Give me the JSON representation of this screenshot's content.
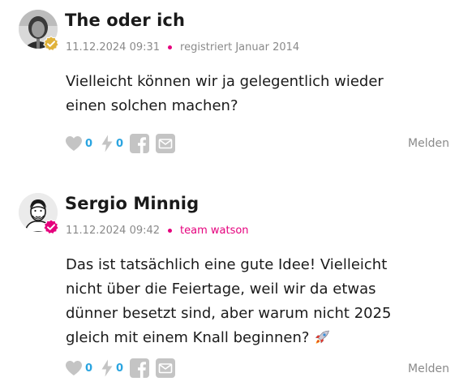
{
  "comments": [
    {
      "author": "The oder ich",
      "timestamp": "11.12.2024 09:31",
      "tag": "registriert Januar 2014",
      "text_lines": [
        "Vielleicht können wir ja gelegentlich wieder",
        "einen solchen machen?"
      ],
      "likes": "0",
      "dislikes": "0",
      "report_label": "Melden",
      "badge_color": "#e0b23a"
    },
    {
      "author": "Sergio Minnig",
      "timestamp": "11.12.2024 09:42",
      "tag": "team watson",
      "text_lines": [
        "Das ist tatsächlich eine gute Idee! Vielleicht",
        "nicht über die Feiertage, weil wir da etwas",
        "dünner besetzt sind, aber warum nicht 2025",
        "gleich mit einem Knall beginnen?"
      ],
      "likes": "0",
      "dislikes": "0",
      "report_label": "Melden",
      "badge_color": "#e5007d"
    }
  ],
  "colors": {
    "accent_pink": "#e5007d",
    "count_blue": "#2aa4e0",
    "icon_gray": "#c4c4c4",
    "meta_gray": "#8a8a8a"
  },
  "icons": [
    "heart-icon",
    "lightning-icon",
    "facebook-icon",
    "mail-icon",
    "rocket-icon",
    "verified-badge-icon"
  ]
}
